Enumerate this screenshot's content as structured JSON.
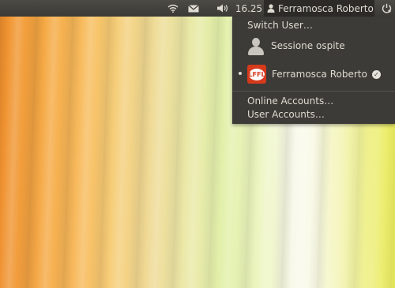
{
  "panel": {
    "icons": {
      "wifi": "wifi-icon",
      "mail": "mail-icon",
      "volume": "volume-icon",
      "user": "user-icon",
      "session": "power-icon"
    },
    "clock": "16.25",
    "user_name": "Ferramosca Roberto"
  },
  "menu": {
    "switch_user": "Switch User…",
    "guest": "Sessione ospite",
    "current_user": {
      "name": "Ferramosca Roberto",
      "avatar_text": "LFFL"
    },
    "online_accounts": "Online Accounts…",
    "user_accounts": "User Accounts…"
  }
}
